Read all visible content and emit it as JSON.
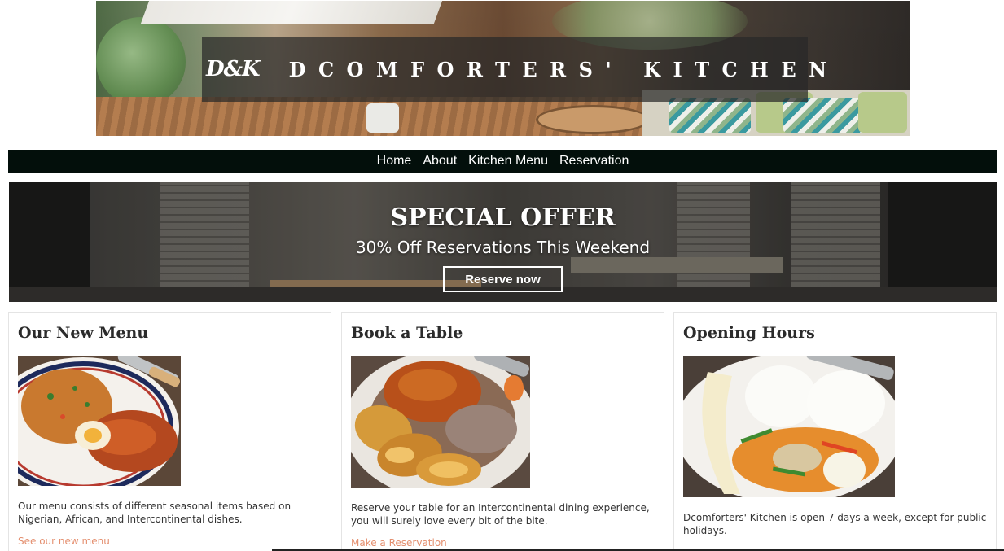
{
  "banner": {
    "logo_text": "D&K",
    "site_name": "DCOMFORTERS' KITCHEN"
  },
  "nav": {
    "items": [
      "Home",
      "About",
      "Kitchen Menu",
      "Reservation"
    ]
  },
  "hero": {
    "title": "SPECIAL OFFER",
    "subtitle": "30% Off Reservations This Weekend",
    "button_label": "Reserve now"
  },
  "cards": [
    {
      "title": "Our New Menu",
      "image_alt": "Jollof rice with chicken and egg",
      "text": "Our menu consists of different seasonal items based on Nigerian, African, and Intercontinental dishes.",
      "link": "See our new menu"
    },
    {
      "title": "Book a Table",
      "image_alt": "Rice with stew and fried plantain",
      "text": "Reserve your table for an Intercontinental dining experience, you will surely love every bit of the bite.",
      "link": "Make a Reservation"
    },
    {
      "title": "Opening Hours",
      "image_alt": "White rice with vegetable stew, egg and plantain",
      "text": "Dcomforters' Kitchen is open 7 days a week, except for public holidays."
    }
  ],
  "colors": {
    "nav_bg": "#030f0b",
    "link": "#e48f6f",
    "heading": "#2b2b2b"
  }
}
